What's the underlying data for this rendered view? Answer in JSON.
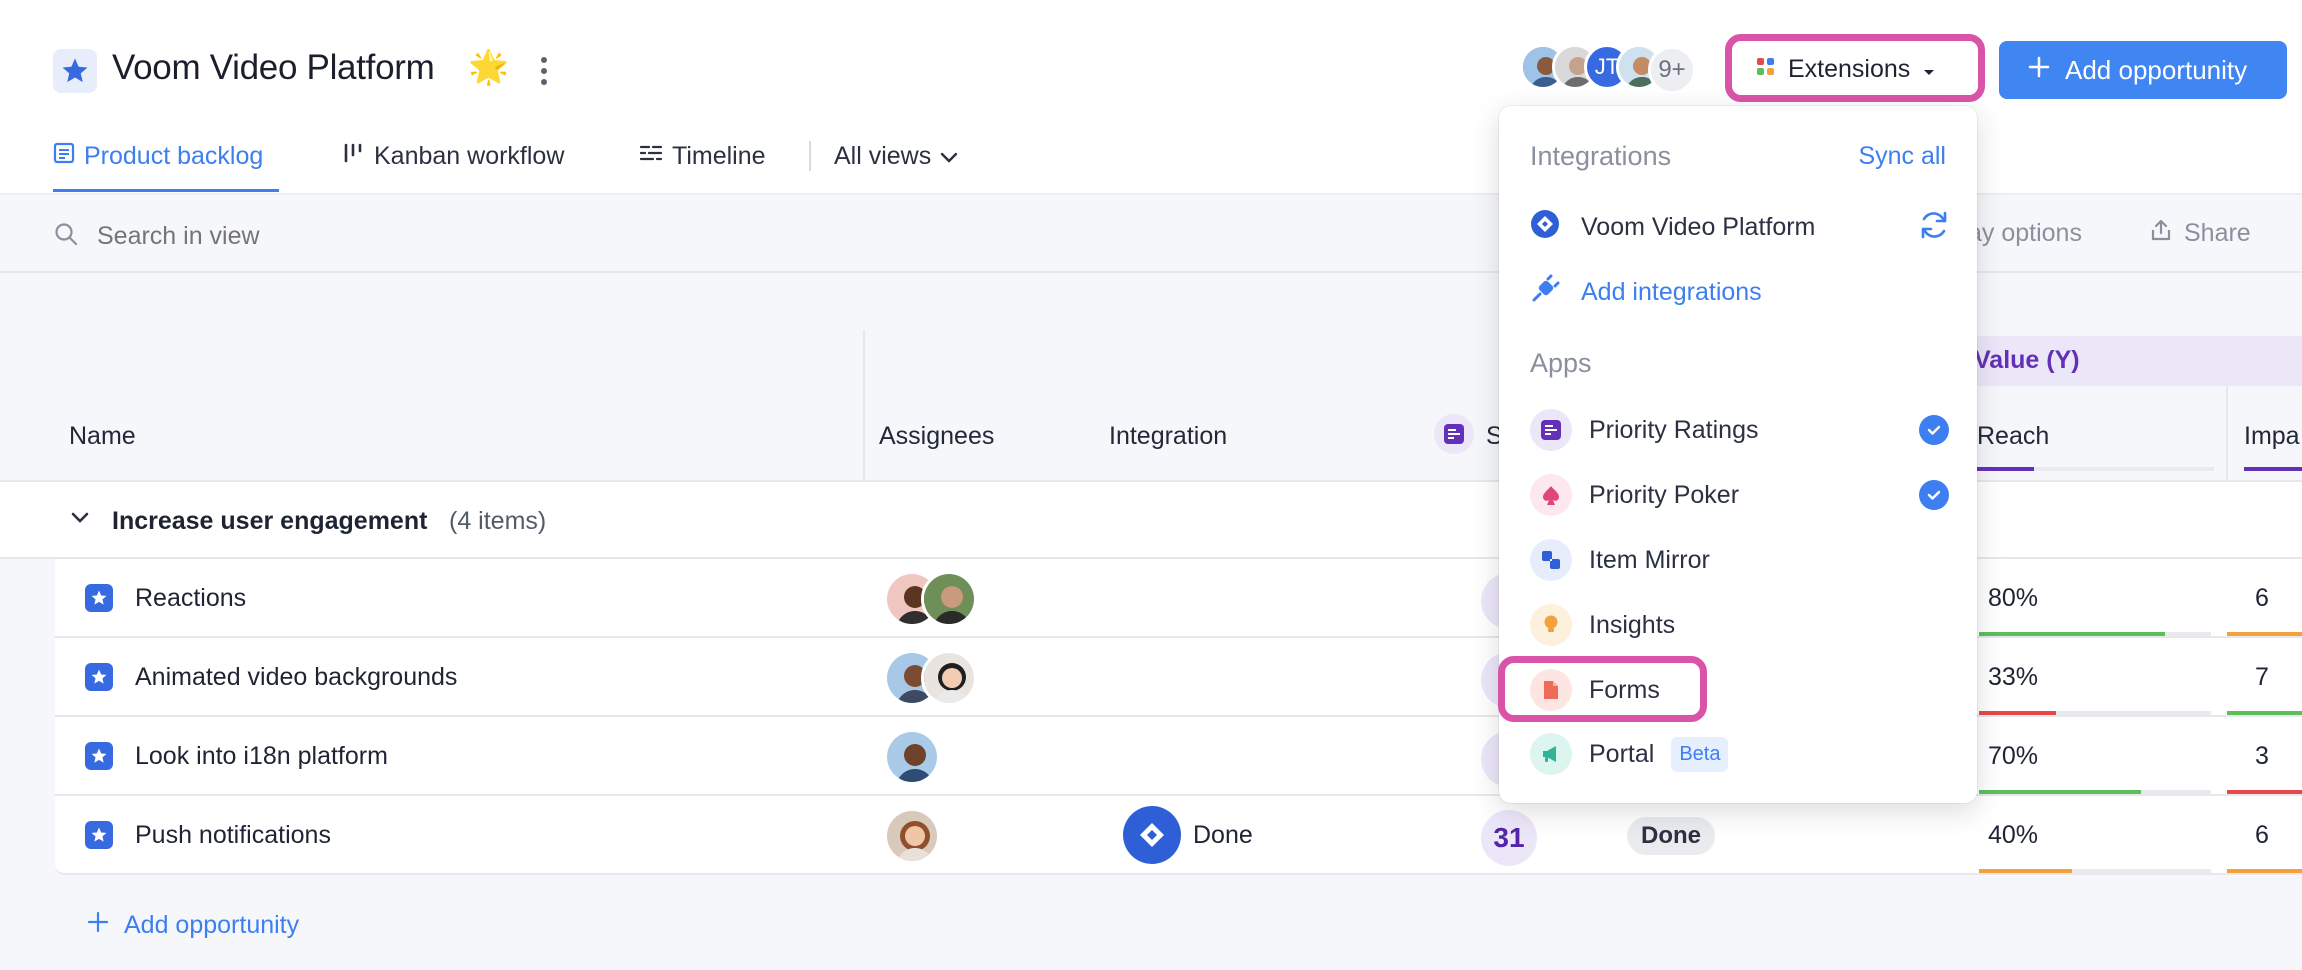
{
  "header": {
    "title": "Voom Video Platform",
    "title_emoji": "🌟",
    "avatar_overflow": "9+",
    "avatar_initials": "JT",
    "extensions_label": "Extensions",
    "add_opportunity_label": "Add opportunity"
  },
  "tabs": [
    {
      "label": "Product backlog",
      "active": true
    },
    {
      "label": "Kanban workflow"
    },
    {
      "label": "Timeline"
    },
    {
      "label": "All views"
    }
  ],
  "toolbar": {
    "search_placeholder": "Search in view",
    "display_options": "ay options",
    "share": "Share"
  },
  "table": {
    "columns": {
      "name": "Name",
      "assignees": "Assignees",
      "integration": "Integration",
      "score_partial": "S",
      "value_group": "Value (Y)",
      "reach": "Reach",
      "impact": "Impa"
    },
    "group": {
      "title": "Increase user engagement",
      "count": "(4 items)"
    },
    "rows": [
      {
        "name": "Reactions",
        "reach": "80%",
        "reach_fraction": 0.8,
        "reach_color": "#5cbf5c",
        "impact": "6",
        "impact_color": "#f3a13c"
      },
      {
        "name": "Animated video backgrounds",
        "reach": "33%",
        "reach_fraction": 0.33,
        "reach_color": "#e5484d",
        "impact": "7",
        "impact_color": "#5cbf5c"
      },
      {
        "name": "Look into i18n platform",
        "reach": "70%",
        "reach_fraction": 0.7,
        "reach_color": "#5cbf5c",
        "impact": "3",
        "impact_color": "#e5484d"
      },
      {
        "name": "Push notifications",
        "integration": "Done",
        "score": "31",
        "status": "Done",
        "reach": "40%",
        "reach_fraction": 0.4,
        "reach_color": "#f3a13c",
        "impact": "6",
        "impact_color": "#f3a13c"
      }
    ],
    "add_opportunity": "Add opportunity"
  },
  "dropdown": {
    "integrations_title": "Integrations",
    "sync_all": "Sync all",
    "integration_item": "Voom Video Platform",
    "add_integrations": "Add integrations",
    "apps_title": "Apps",
    "apps": [
      {
        "label": "Priority Ratings",
        "checked": true
      },
      {
        "label": "Priority Poker",
        "checked": true
      },
      {
        "label": "Item Mirror",
        "checked": false
      },
      {
        "label": "Insights",
        "checked": false
      },
      {
        "label": "Forms",
        "checked": false
      },
      {
        "label": "Portal",
        "checked": false,
        "badge": "Beta"
      }
    ]
  },
  "colors": {
    "accent": "#3f86f2",
    "highlight": "#d954a8",
    "value_purple": "#6331b8"
  }
}
